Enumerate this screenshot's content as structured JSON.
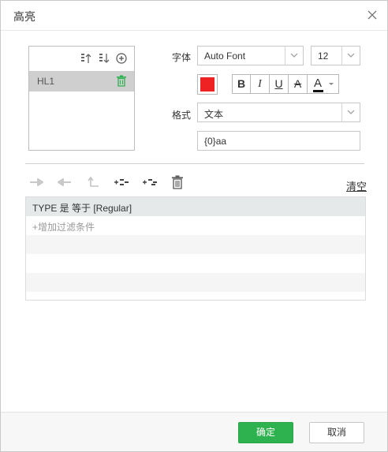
{
  "dialog": {
    "title": "高亮"
  },
  "highlight_list": {
    "items": [
      {
        "label": "HL1",
        "selected": true
      }
    ]
  },
  "font": {
    "label": "字体",
    "family": "Auto Font",
    "size": "12"
  },
  "style": {
    "color": "#ee2222",
    "bold": "B",
    "italic": "I",
    "underline": "U",
    "strikethrough": "A",
    "text_color_glyph": "A",
    "text_color": "#111111"
  },
  "format": {
    "label": "格式",
    "type": "文本",
    "pattern": "{0}aa"
  },
  "filter": {
    "clear_label": "清空",
    "conditions": [
      "TYPE 是 等于 [Regular]"
    ],
    "add_label": "+增加过滤条件"
  },
  "footer": {
    "ok_label": "确定",
    "cancel_label": "取消"
  },
  "colors": {
    "accent": "#2eb14f",
    "selected_row": "#cfcfcf",
    "condition_row": "#e5e9ea"
  }
}
